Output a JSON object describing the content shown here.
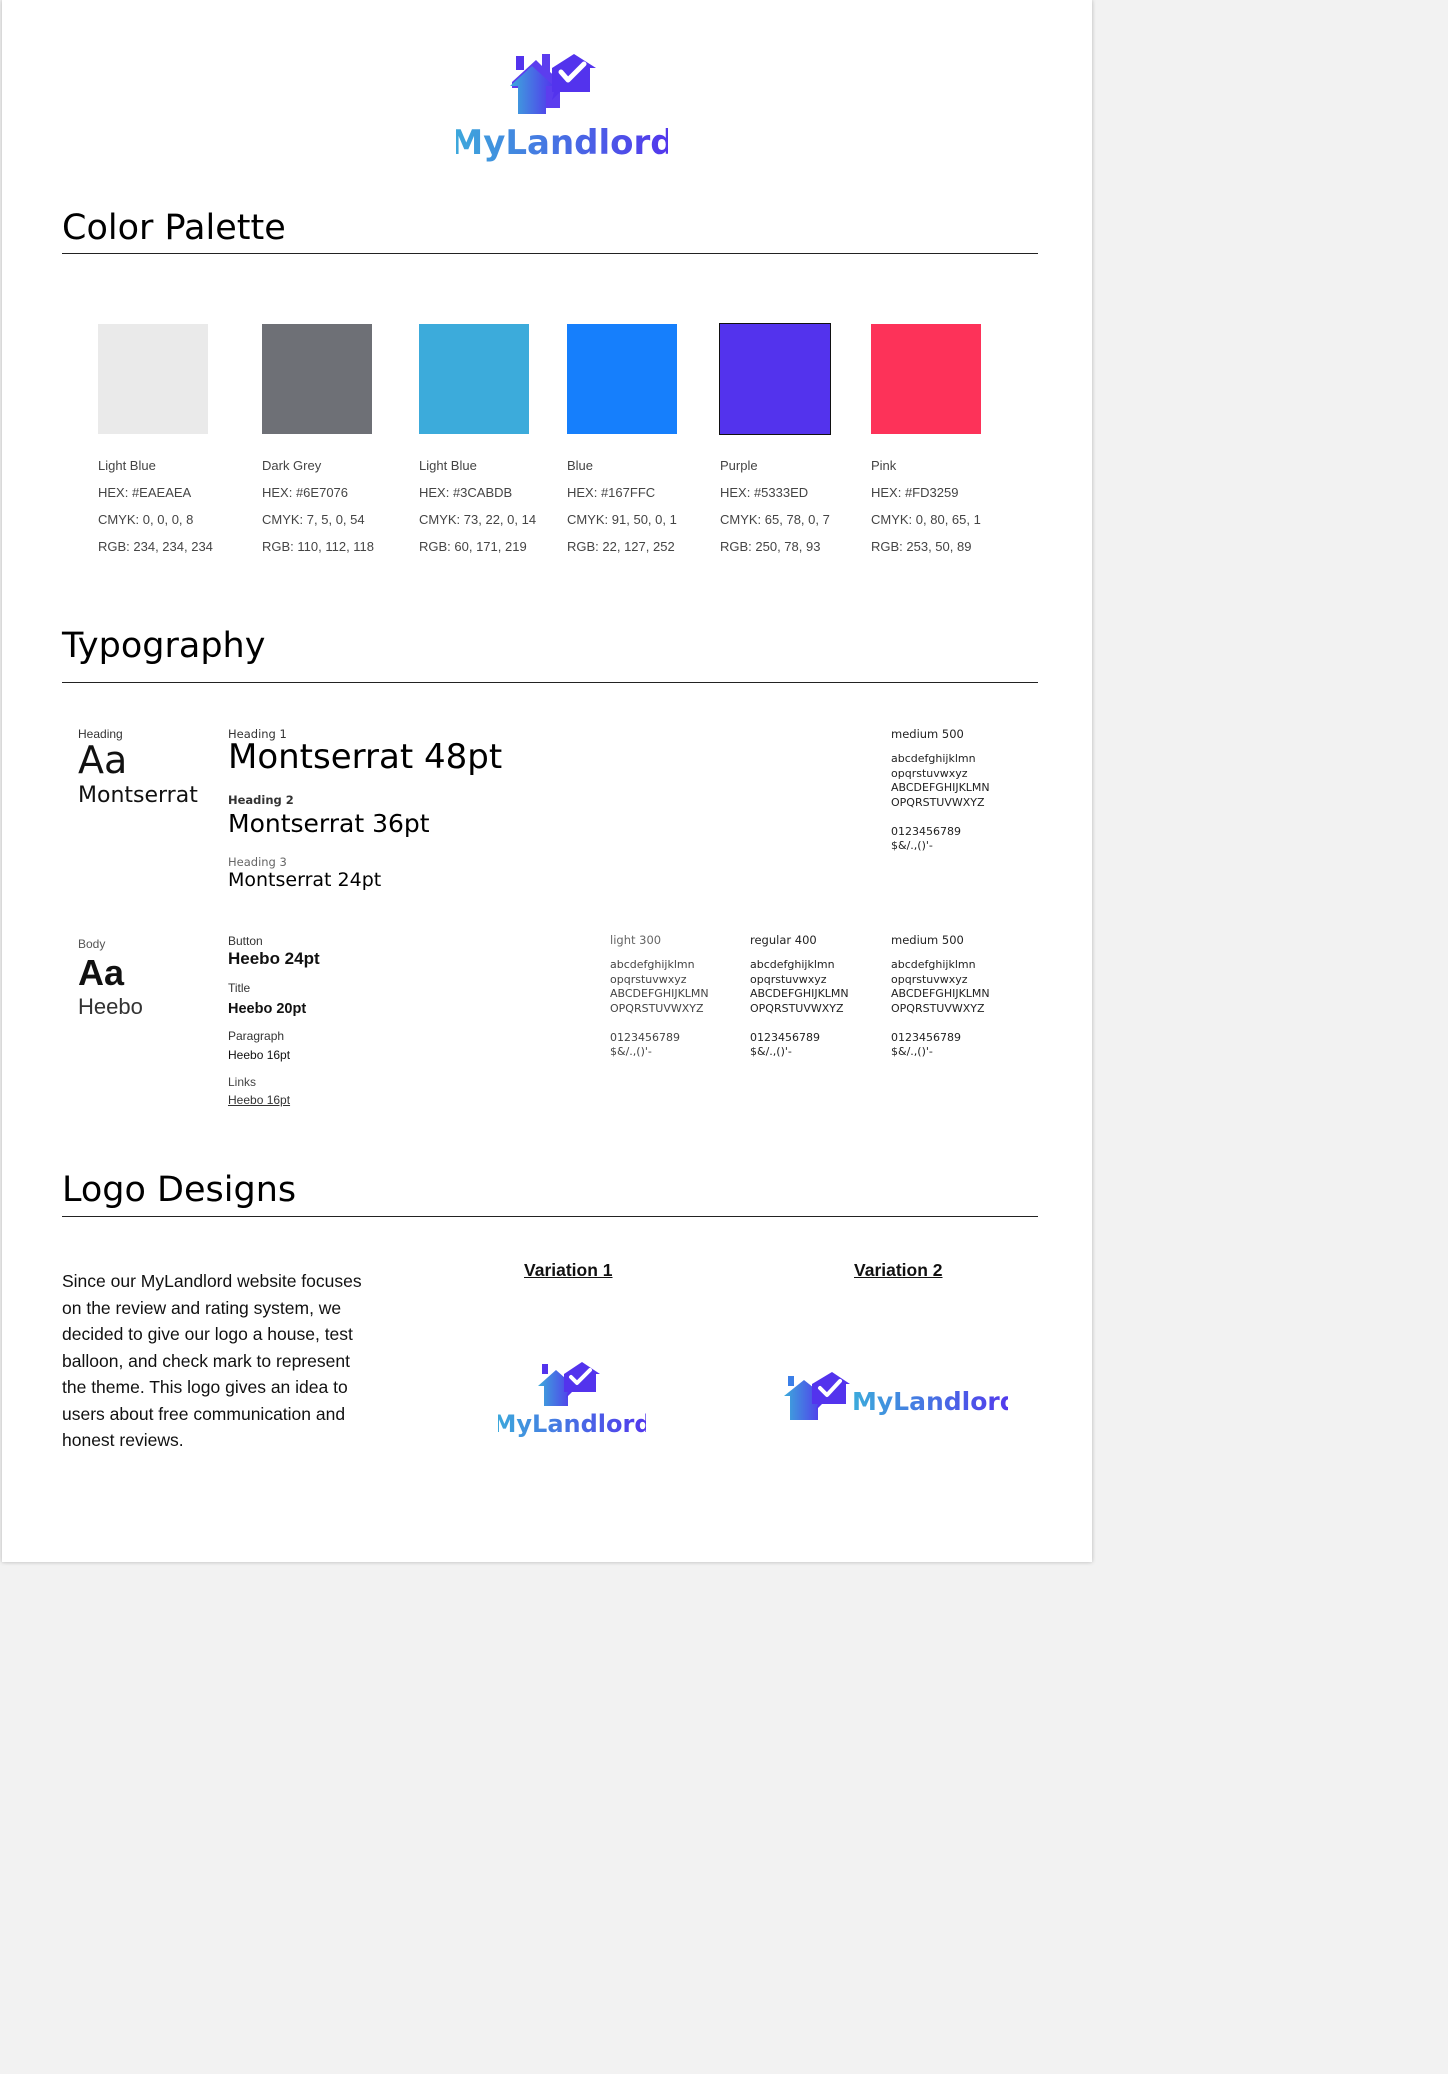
{
  "brand": {
    "name": "MyLandlord",
    "colors": {
      "logo_start": "#3CABDB",
      "logo_end": "#5333ED",
      "rule": "#222222"
    }
  },
  "sections": {
    "color_palette": "Color Palette",
    "typography": "Typography",
    "logo_designs": "Logo Designs"
  },
  "palette": [
    {
      "name": "Light Blue",
      "hex_label": "HEX: #EAEAEA",
      "cmyk": "CMYK: 0, 0, 0, 8",
      "rgb": "RGB: 234, 234, 234",
      "color": "#EAEAEA"
    },
    {
      "name": "Dark Grey",
      "hex_label": "HEX: #6E7076",
      "cmyk": "CMYK: 7, 5, 0, 54",
      "rgb": "RGB: 110, 112, 118",
      "color": "#6E7076"
    },
    {
      "name": "Light Blue",
      "hex_label": "HEX: #3CABDB",
      "cmyk": "CMYK: 73, 22, 0, 14",
      "rgb": "RGB: 60, 171, 219",
      "color": "#3CABDB"
    },
    {
      "name": "Blue",
      "hex_label": "HEX: #167FFC",
      "cmyk": "CMYK: 91, 50, 0, 1",
      "rgb": "RGB: 22, 127, 252",
      "color": "#167FFC"
    },
    {
      "name": "Purple",
      "hex_label": "HEX: #5333ED",
      "cmyk": "CMYK: 65, 78, 0, 7",
      "rgb": "RGB: 250, 78, 93",
      "color": "#5333ED"
    },
    {
      "name": "Pink",
      "hex_label": "HEX: #FD3259",
      "cmyk": "CMYK: 0, 80, 65, 1",
      "rgb": "RGB: 253, 50, 89",
      "color": "#FD3259"
    }
  ],
  "typography": {
    "heading": {
      "label": "Heading",
      "sample": "Aa",
      "font": "Montserrat",
      "h1_label": "Heading 1",
      "h1": "Montserrat 48pt",
      "h2_label": "Heading 2",
      "h2": "Montserrat 36pt",
      "h3_label": "Heading 3",
      "h3": "Montserrat 24pt",
      "weight": "medium 500",
      "spec": "abcdefghijklmn\nopqrstuvwxyz\nABCDEFGHIJKLMN\nOPQRSTUVWXYZ\n\n0123456789\n$&/.,()'-"
    },
    "body": {
      "label": "Body",
      "sample": "Aa",
      "font": "Heebo",
      "button_label": "Button",
      "button": "Heebo 24pt",
      "title_label": "Title",
      "title": "Heebo 20pt",
      "paragraph_label": "Paragraph",
      "paragraph": "Heebo 16pt",
      "links_label": "Links",
      "links": "Heebo 16pt",
      "weights": [
        {
          "name": "light 300",
          "spec": "abcdefghijklmn\nopqrstuvwxyz\nABCDEFGHIJKLMN\nOPQRSTUVWXYZ\n\n0123456789\n$&/.,()'-"
        },
        {
          "name": "regular 400",
          "spec": "abcdefghijklmn\nopqrstuvwxyz\nABCDEFGHIJKLMN\nOPQRSTUVWXYZ\n\n0123456789\n$&/.,()'-"
        },
        {
          "name": "medium 500",
          "spec": "abcdefghijklmn\nopqrstuvwxyz\nABCDEFGHIJKLMN\nOPQRSTUVWXYZ\n\n0123456789\n$&/.,()'-"
        }
      ]
    }
  },
  "logo_designs": {
    "description": "Since our MyLandlord website focuses on the review and rating system, we decided to give our logo a house, test balloon, and check mark to represent the theme. This logo gives an idea to users about free communication and honest reviews.",
    "variation_1": "Variation 1",
    "variation_2": "Variation 2"
  },
  "icons": [
    "house-check-icon"
  ]
}
